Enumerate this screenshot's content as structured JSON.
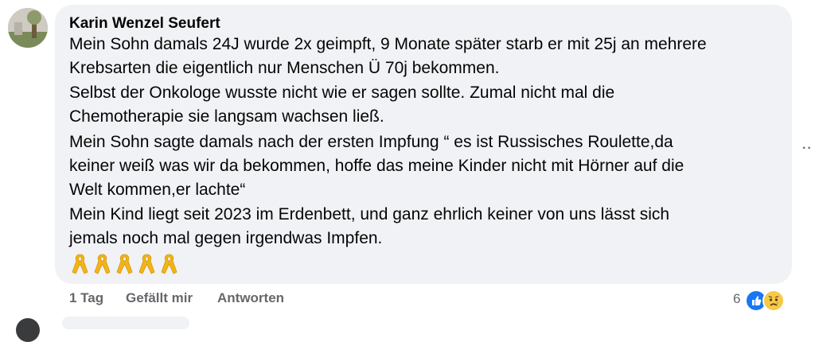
{
  "comment": {
    "author": "Karin Wenzel Seufert",
    "lines": [
      "Mein Sohn damals 24J wurde 2x geimpft, 9 Monate später starb er mit 25j an mehrere",
      "Krebsarten die eigentlich nur Menschen Ü 70j bekommen.",
      "Selbst der Onkologe wusste nicht wie er sagen sollte. Zumal nicht mal die",
      "Chemotherapie sie langsam wachsen ließ.",
      "Mein Sohn sagte damals nach der ersten Impfung “ es ist Russisches Roulette,da",
      "keiner weiß was wir da bekommen, hoffe das meine Kinder nicht mit Hörner auf die",
      "Welt kommen,er lachte“",
      "Mein Kind liegt seit 2023 im Erdenbett, und ganz ehrlich keiner von uns lässt sich",
      "jemals noch mal gegen irgendwas Impfen."
    ],
    "emoji_icon": "yellow-ribbon-icon",
    "emoji_count": 5
  },
  "actions": {
    "time": "1 Tag",
    "like_label": "Gefällt mir",
    "reply_label": "Antworten"
  },
  "reactions": {
    "count": "6",
    "icons": [
      "like-icon",
      "sad-icon"
    ]
  },
  "colors": {
    "bubble": "#f0f2f5",
    "text": "#050505",
    "secondary": "#65676b",
    "like_blue": "#1877f2",
    "ribbon_yellow": "#f2b417"
  }
}
